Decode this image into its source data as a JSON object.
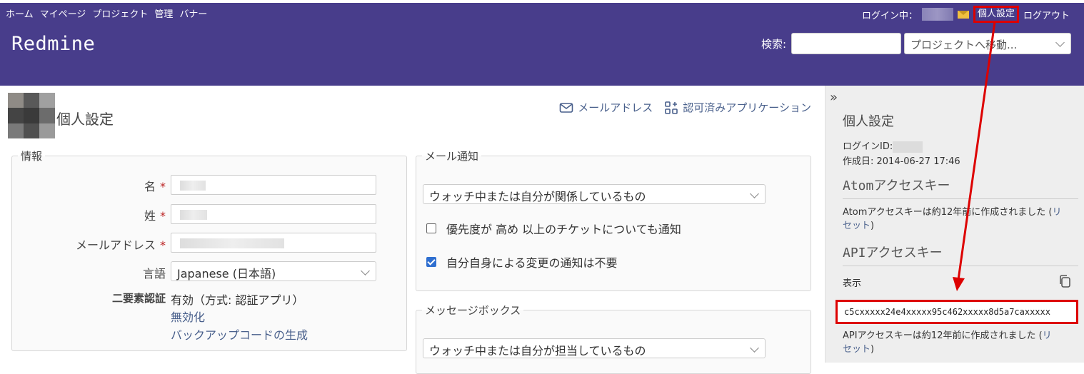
{
  "top_menu": {
    "home": "ホーム",
    "my_page": "マイページ",
    "projects": "プロジェクト",
    "admin": "管理",
    "banner": "バナー",
    "logged_in_as": "ログイン中：",
    "my_account": "個人設定",
    "logout": "ログアウト"
  },
  "header": {
    "title": "Redmine",
    "search_label": "検索:",
    "search_value": "",
    "project_jump": "プロジェクトへ移動..."
  },
  "page": {
    "title": "個人設定",
    "email_link": "メールアドレス",
    "apps_link": "認可済みアプリケーション"
  },
  "info": {
    "legend": "情報",
    "firstname_label": "名",
    "lastname_label": "姓",
    "email_label": "メールアドレス",
    "required_mark": "*",
    "language_label": "言語",
    "language_value": "Japanese (日本語)",
    "twofa_label": "二要素認証",
    "twofa_status": "有効（方式: 認証アプリ）",
    "twofa_disable": "無効化",
    "twofa_backup": "バックアップコードの生成"
  },
  "mail_notification": {
    "legend": "メール通知",
    "select_value": "ウォッチ中または自分が関係しているもの",
    "priority_label": "優先度が 高め 以上のチケットについても通知",
    "priority_checked": false,
    "no_self_label": "自分自身による変更の通知は不要",
    "no_self_checked": true
  },
  "messagebox": {
    "legend": "メッセージボックス",
    "select_value": "ウォッチ中または自分が担当しているもの"
  },
  "sidebar": {
    "toggle": "»",
    "title": "個人設定",
    "login_id_label": "ログインID:",
    "created_label": "作成日: 2014-06-27 17:46",
    "atom_title": "Atomアクセスキー",
    "atom_text": "Atomアクセスキーは約12年前に作成されました (",
    "atom_reset_1": "リ",
    "atom_reset_2": "セット",
    "close_paren": ")",
    "api_title": "APIアクセスキー",
    "api_show": "表示",
    "api_key": "c5cxxxxx24e4xxxxx95c462xxxxx8d5a7caxxxxx",
    "api_text": "APIアクセスキーは約12年前に作成されました (",
    "api_reset_1": "リ",
    "api_reset_2": "セット"
  },
  "colors": {
    "header_bg": "#483d8b",
    "highlight": "#dd0000",
    "link": "#485f8b"
  }
}
